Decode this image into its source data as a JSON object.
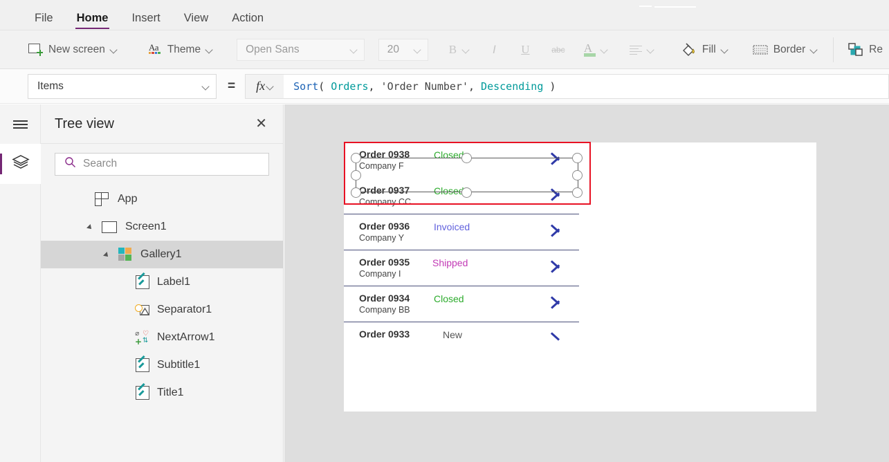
{
  "app": {
    "menu": [
      {
        "label": "File",
        "active": false
      },
      {
        "label": "Home",
        "active": true
      },
      {
        "label": "Insert",
        "active": false
      },
      {
        "label": "View",
        "active": false
      },
      {
        "label": "Action",
        "active": false
      }
    ]
  },
  "ribbon": {
    "new_screen_label": "New screen",
    "theme_label": "Theme",
    "font_name": "Open Sans",
    "font_size": "20",
    "bold": "B",
    "italic": "I",
    "underline": "U",
    "strikethrough": "abc",
    "font_color": "A",
    "fill_label": "Fill",
    "border_label": "Border",
    "reorder_label": "Re"
  },
  "formula_bar": {
    "property": "Items",
    "equals": "=",
    "fx": "fx",
    "formula_tokens": [
      {
        "text": "Sort",
        "type": "fn"
      },
      {
        "text": "( ",
        "type": "punc"
      },
      {
        "text": "Orders",
        "type": "id"
      },
      {
        "text": ", ",
        "type": "punc"
      },
      {
        "text": "'Order Number'",
        "type": "str"
      },
      {
        "text": ", ",
        "type": "punc"
      },
      {
        "text": "Descending",
        "type": "id"
      },
      {
        "text": " )",
        "type": "punc"
      }
    ],
    "formula_text": "Sort( Orders, 'Order Number', Descending )"
  },
  "tree_panel": {
    "title": "Tree view",
    "close": "✕",
    "search_placeholder": "Search",
    "nodes": [
      {
        "label": "App",
        "icon": "app-icon",
        "indent": 0,
        "caret": false,
        "selected": false
      },
      {
        "label": "Screen1",
        "icon": "screen-icon",
        "indent": 0,
        "caret": true,
        "selected": false
      },
      {
        "label": "Gallery1",
        "icon": "gallery-icon",
        "indent": 1,
        "caret": true,
        "selected": true
      },
      {
        "label": "Label1",
        "icon": "label-icon",
        "indent": 2,
        "caret": false,
        "selected": false
      },
      {
        "label": "Separator1",
        "icon": "separator-icon",
        "indent": 2,
        "caret": false,
        "selected": false
      },
      {
        "label": "NextArrow1",
        "icon": "nextarrow-icon",
        "indent": 2,
        "caret": false,
        "selected": false
      },
      {
        "label": "Subtitle1",
        "icon": "label-icon",
        "indent": 2,
        "caret": false,
        "selected": false
      },
      {
        "label": "Title1",
        "icon": "label-icon",
        "indent": 2,
        "caret": false,
        "selected": false
      }
    ]
  },
  "canvas": {
    "gallery_rows": [
      {
        "title": "Order 0938",
        "subtitle": "Company F",
        "status": "Closed",
        "status_color": "#2cab2c",
        "selected": true,
        "arrow": "full"
      },
      {
        "title": "Order 0937",
        "subtitle": "Company CC",
        "status": "Closed",
        "status_color": "#2cab2c",
        "selected": false,
        "arrow": "full"
      },
      {
        "title": "Order 0936",
        "subtitle": "Company Y",
        "status": "Invoiced",
        "status_color": "#6161dd",
        "selected": false,
        "arrow": "full"
      },
      {
        "title": "Order 0935",
        "subtitle": "Company I",
        "status": "Shipped",
        "status_color": "#c23ab5",
        "status_left": "128",
        "selected": false,
        "arrow": "full"
      },
      {
        "title": "Order 0934",
        "subtitle": "Company BB",
        "status": "Closed",
        "status_color": "#2cab2c",
        "selected": false,
        "arrow": "full"
      },
      {
        "title": "Order 0933",
        "subtitle": "",
        "status": "New",
        "status_color": "#555555",
        "status_left": "143",
        "selected": false,
        "arrow": "half"
      }
    ]
  },
  "colors": {
    "accent_purple": "#742774",
    "selection_red": "#e81123",
    "canvas_bg": "#dedede",
    "panel_bg": "#f4f4f4",
    "ribbon_bg": "#f2f2f2"
  }
}
